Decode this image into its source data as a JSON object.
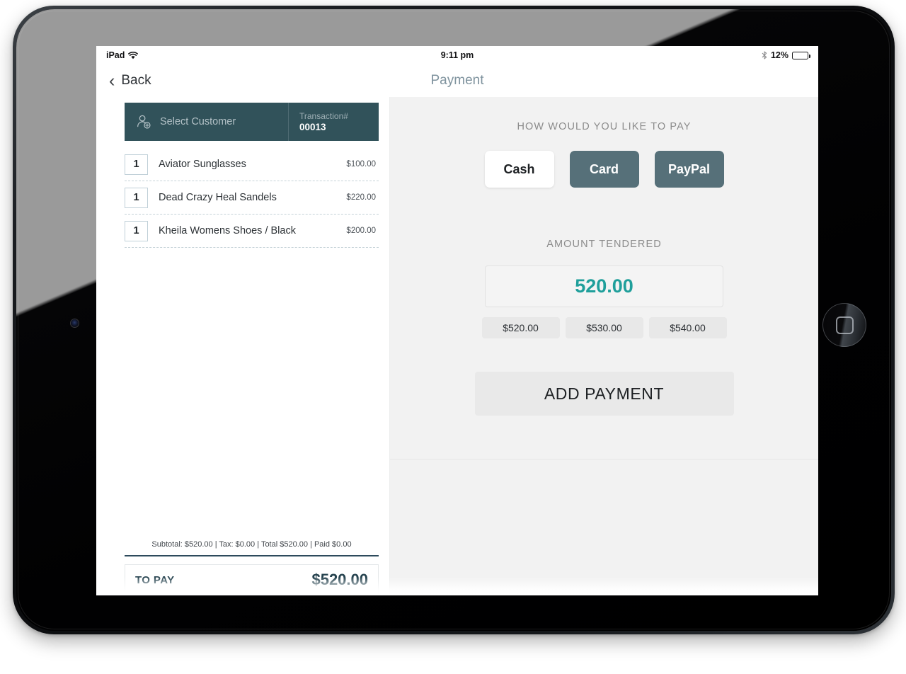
{
  "status_bar": {
    "device_label": "iPad",
    "wifi_icon": "wifi-icon",
    "time": "9:11 pm",
    "bluetooth_icon": "bluetooth-icon",
    "battery_percent": "12%",
    "battery_level": 12
  },
  "nav": {
    "back_label": "Back",
    "back_icon": "chevron-left-icon",
    "title": "Payment"
  },
  "cart": {
    "select_customer_label": "Select Customer",
    "customer_icon": "add-person-icon",
    "transaction_label": "Transaction#",
    "transaction_number": "00013",
    "items": [
      {
        "qty": "1",
        "name": "Aviator Sunglasses",
        "price": "$100.00"
      },
      {
        "qty": "1",
        "name": "Dead Crazy Heal Sandels",
        "price": "$220.00"
      },
      {
        "qty": "1",
        "name": "Kheila Womens Shoes / Black",
        "price": "$200.00"
      }
    ],
    "summary": "Subtotal: $520.00 | Tax: $0.00 | Total $520.00 | Paid $0.00",
    "to_pay_label": "TO PAY",
    "to_pay_amount": "$520.00"
  },
  "payment": {
    "method_caption": "HOW WOULD YOU LIKE TO PAY",
    "methods": [
      {
        "label": "Cash",
        "selected": true
      },
      {
        "label": "Card",
        "selected": false
      },
      {
        "label": "PayPal",
        "selected": false
      }
    ],
    "tendered_caption": "AMOUNT TENDERED",
    "tendered_value": "520.00",
    "quick_amounts": [
      "$520.00",
      "$530.00",
      "$540.00"
    ],
    "add_payment_label": "ADD PAYMENT"
  },
  "colors": {
    "teal_header": "#31525a",
    "accent_teal": "#1f9f9b",
    "method_unselected": "#567079",
    "to_pay_text": "#24414d",
    "panel_background": "#f2f2f2"
  }
}
